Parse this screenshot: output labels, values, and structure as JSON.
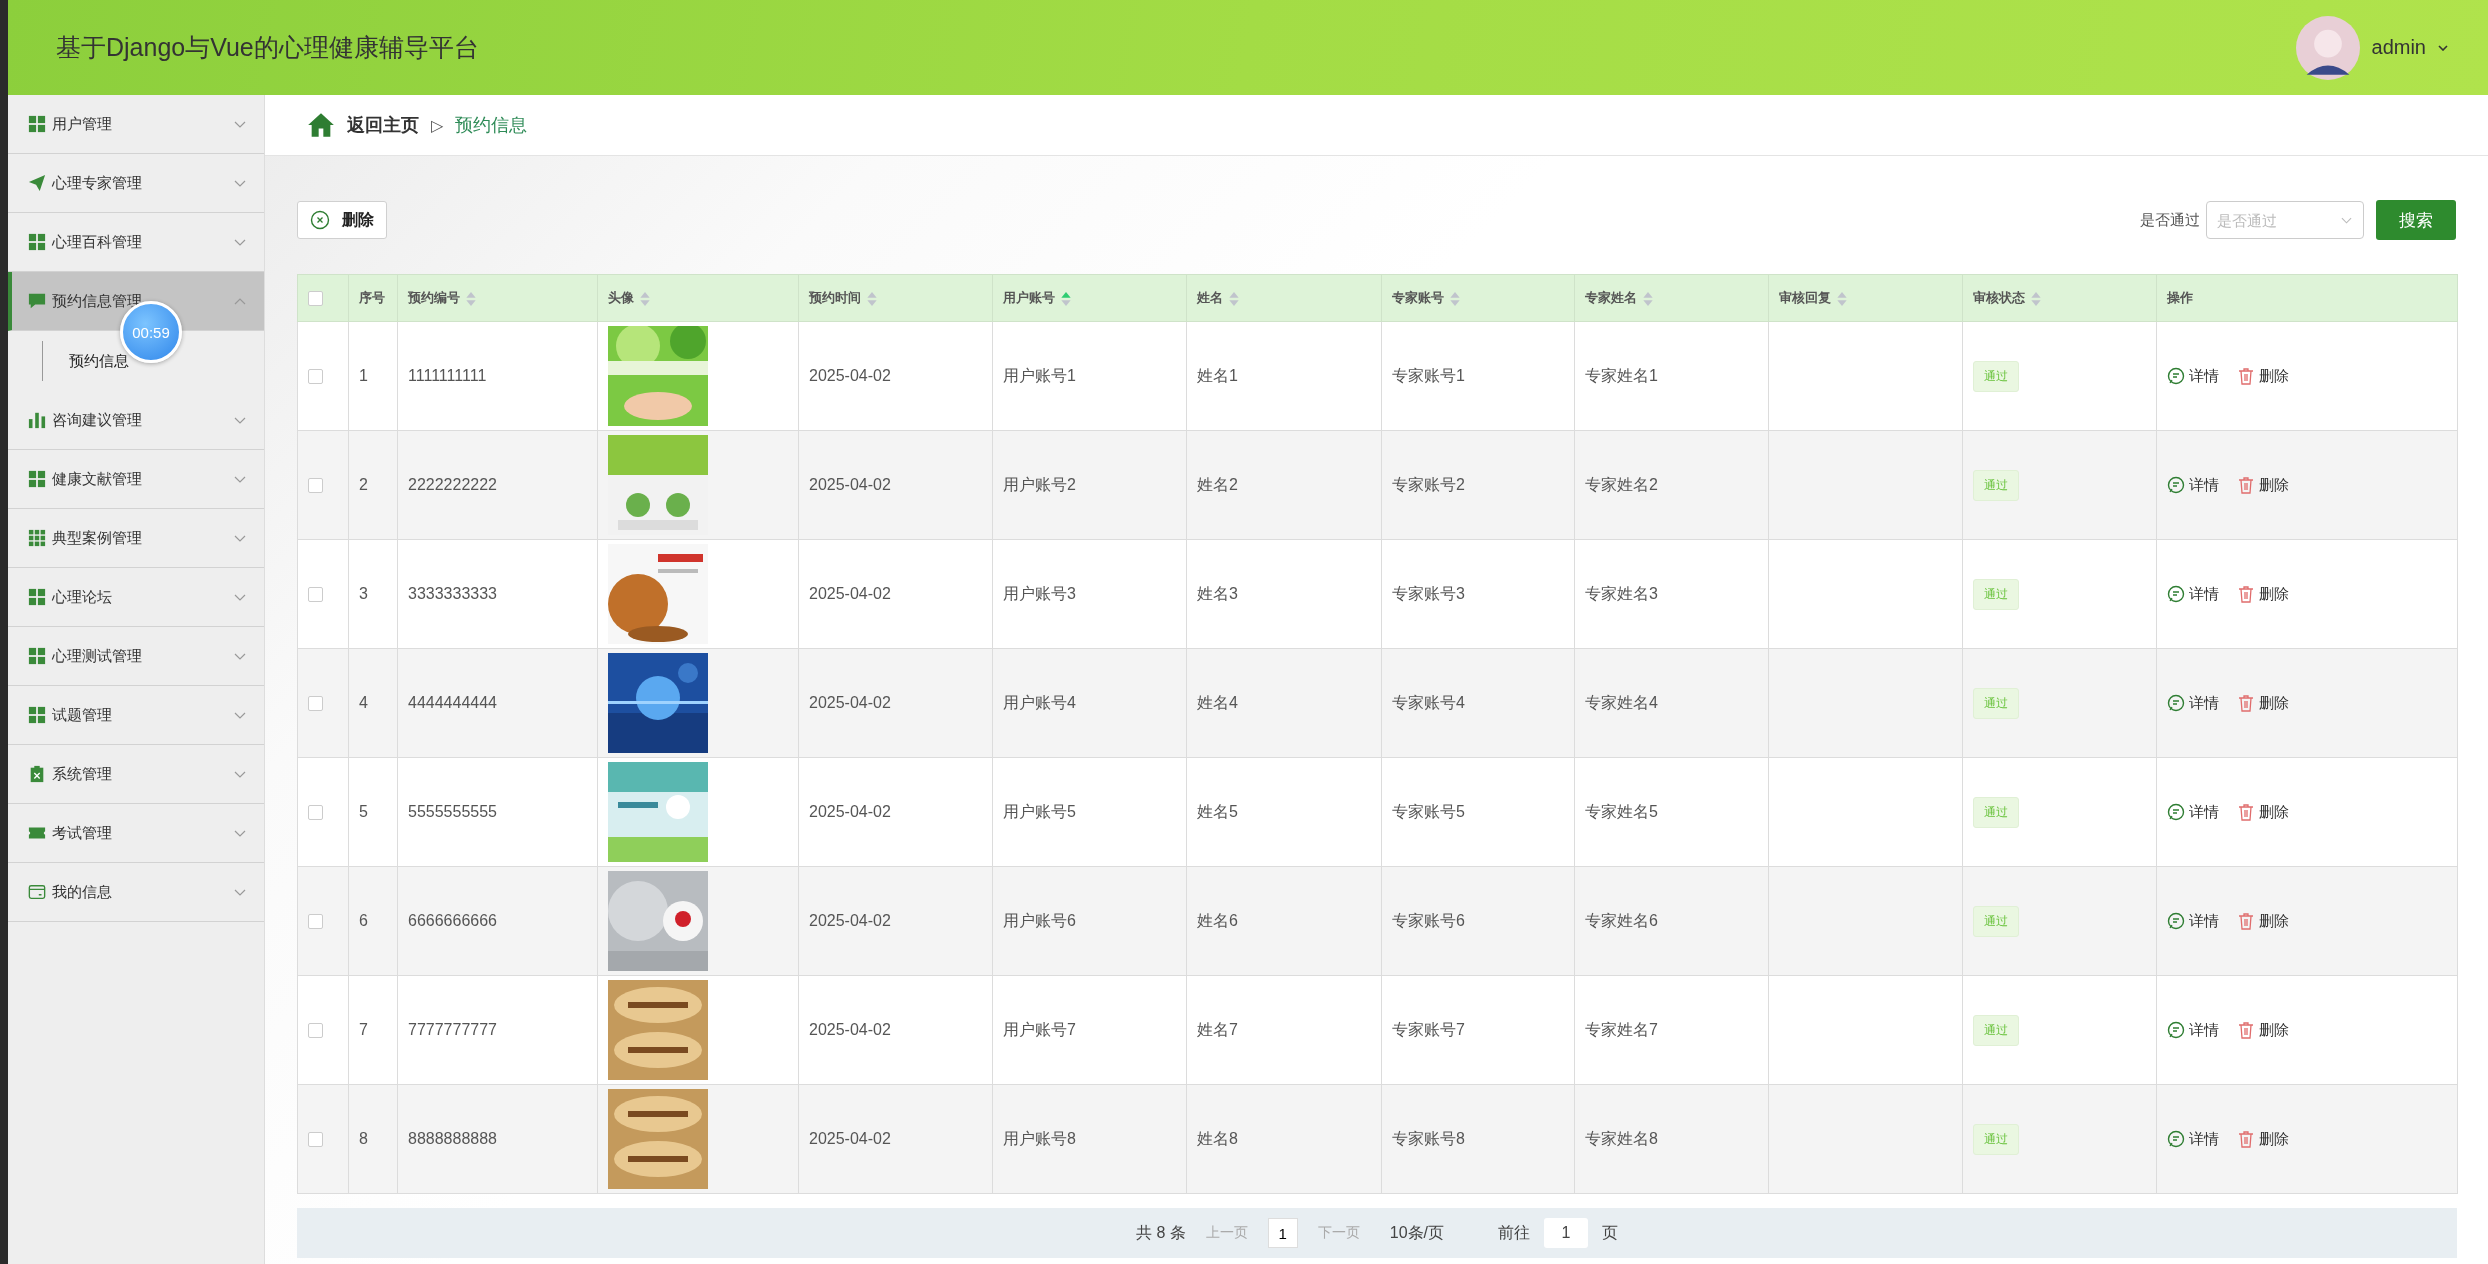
{
  "header": {
    "title": "基于Django与Vue的心理健康辅导平台",
    "user": "admin"
  },
  "sidebar": {
    "items": [
      {
        "label": "用户管理",
        "expanded": false,
        "selected": false
      },
      {
        "label": "心理专家管理",
        "expanded": false,
        "selected": false
      },
      {
        "label": "心理百科管理",
        "expanded": false,
        "selected": false
      },
      {
        "label": "预约信息管理",
        "expanded": true,
        "selected": true,
        "children": [
          {
            "label": "预约信息"
          }
        ]
      },
      {
        "label": "咨询建议管理",
        "expanded": false,
        "selected": false
      },
      {
        "label": "健康文献管理",
        "expanded": false,
        "selected": false
      },
      {
        "label": "典型案例管理",
        "expanded": false,
        "selected": false
      },
      {
        "label": "心理论坛",
        "expanded": false,
        "selected": false
      },
      {
        "label": "心理测试管理",
        "expanded": false,
        "selected": false
      },
      {
        "label": "试题管理",
        "expanded": false,
        "selected": false
      },
      {
        "label": "系统管理",
        "expanded": false,
        "selected": false
      },
      {
        "label": "考试管理",
        "expanded": false,
        "selected": false
      },
      {
        "label": "我的信息",
        "expanded": false,
        "selected": false
      }
    ]
  },
  "timer": "00:59",
  "breadcrumb": {
    "home": "返回主页",
    "separator": "▷",
    "current": "预约信息"
  },
  "toolbar": {
    "delete": "删除",
    "filter_label": "是否通过",
    "filter": {
      "placeholder": "是否通过"
    },
    "search": "搜索"
  },
  "table": {
    "header_checked": false,
    "columns": [
      {
        "label": "序号",
        "sortable": false
      },
      {
        "label": "预约编号",
        "sortable": true,
        "sorted": false
      },
      {
        "label": "头像",
        "sortable": true,
        "sorted": false
      },
      {
        "label": "预约时间",
        "sortable": true,
        "sorted": false
      },
      {
        "label": "用户账号",
        "sortable": true,
        "sorted": true
      },
      {
        "label": "姓名",
        "sortable": true,
        "sorted": false
      },
      {
        "label": "专家账号",
        "sortable": true,
        "sorted": false
      },
      {
        "label": "专家姓名",
        "sortable": true,
        "sorted": false
      },
      {
        "label": "审核回复",
        "sortable": true,
        "sorted": false
      },
      {
        "label": "审核状态",
        "sortable": true,
        "sorted": false
      },
      {
        "label": "操作",
        "sortable": false
      }
    ],
    "rows": [
      {
        "checked": false,
        "index": "1",
        "code": "1111111111",
        "time": "2025-04-02",
        "user": "用户账号1",
        "name": "姓名1",
        "expert": "专家账号1",
        "expert_name": "专家姓名1",
        "reply": "",
        "status": "通过",
        "actions": [
          "详情",
          "删除"
        ]
      },
      {
        "checked": false,
        "index": "2",
        "code": "2222222222",
        "time": "2025-04-02",
        "user": "用户账号2",
        "name": "姓名2",
        "expert": "专家账号2",
        "expert_name": "专家姓名2",
        "reply": "",
        "status": "通过",
        "actions": [
          "详情",
          "删除"
        ]
      },
      {
        "checked": false,
        "index": "3",
        "code": "3333333333",
        "time": "2025-04-02",
        "user": "用户账号3",
        "name": "姓名3",
        "expert": "专家账号3",
        "expert_name": "专家姓名3",
        "reply": "",
        "status": "通过",
        "actions": [
          "详情",
          "删除"
        ]
      },
      {
        "checked": false,
        "index": "4",
        "code": "4444444444",
        "time": "2025-04-02",
        "user": "用户账号4",
        "name": "姓名4",
        "expert": "专家账号4",
        "expert_name": "专家姓名4",
        "reply": "",
        "status": "通过",
        "actions": [
          "详情",
          "删除"
        ]
      },
      {
        "checked": false,
        "index": "5",
        "code": "5555555555",
        "time": "2025-04-02",
        "user": "用户账号5",
        "name": "姓名5",
        "expert": "专家账号5",
        "expert_name": "专家姓名5",
        "reply": "",
        "status": "通过",
        "actions": [
          "详情",
          "删除"
        ]
      },
      {
        "checked": false,
        "index": "6",
        "code": "6666666666",
        "time": "2025-04-02",
        "user": "用户账号6",
        "name": "姓名6",
        "expert": "专家账号6",
        "expert_name": "专家姓名6",
        "reply": "",
        "status": "通过",
        "actions": [
          "详情",
          "删除"
        ]
      },
      {
        "checked": false,
        "index": "7",
        "code": "7777777777",
        "time": "2025-04-02",
        "user": "用户账号7",
        "name": "姓名7",
        "expert": "专家账号7",
        "expert_name": "专家姓名7",
        "reply": "",
        "status": "通过",
        "actions": [
          "详情",
          "删除"
        ]
      },
      {
        "checked": false,
        "index": "8",
        "code": "8888888888",
        "time": "2025-04-02",
        "user": "用户账号8",
        "name": "姓名8",
        "expert": "专家账号8",
        "expert_name": "专家姓名8",
        "reply": "",
        "status": "通过",
        "actions": [
          "详情",
          "删除"
        ]
      }
    ]
  },
  "pagination": {
    "total": "共 8 条",
    "prev": "上一页",
    "page": "1",
    "next": "下一页",
    "size": "10条/页",
    "goto": "前往",
    "goto_value": "1",
    "unit": "页"
  }
}
